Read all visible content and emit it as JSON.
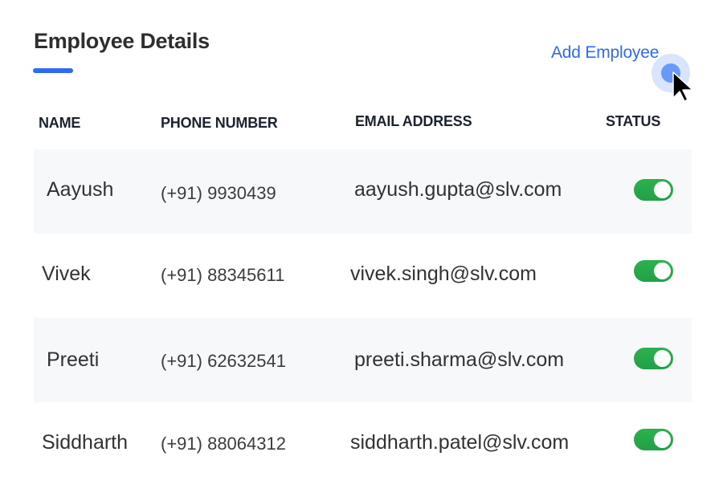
{
  "header": {
    "title": "Employee Details",
    "add_button_label": "Add Employee"
  },
  "colors": {
    "accent": "#2f6af5",
    "toggle_on": "#2db14f",
    "row_shade": "#f7f8fa",
    "text": "#303236"
  },
  "table": {
    "columns": [
      "NAME",
      "PHONE NUMBER",
      "EMAIL ADDRESS",
      "STATUS"
    ],
    "rows": [
      {
        "name": "Aayush",
        "phone": "(+91) 9930439",
        "email": "aayush.gupta@slv.com",
        "status": "active"
      },
      {
        "name": "Vivek",
        "phone": "(+91) 88345611",
        "email": "vivek.singh@slv.com",
        "status": "active"
      },
      {
        "name": "Preeti",
        "phone": "(+91) 62632541",
        "email": "preeti.sharma@slv.com",
        "status": "active"
      },
      {
        "name": "Siddharth",
        "phone": "(+91) 88064312",
        "email": "siddharth.patel@slv.com",
        "status": "active"
      }
    ]
  },
  "icons": {
    "cursor": "mouse-pointer-arrow",
    "click_indicator": "click-ripple"
  }
}
